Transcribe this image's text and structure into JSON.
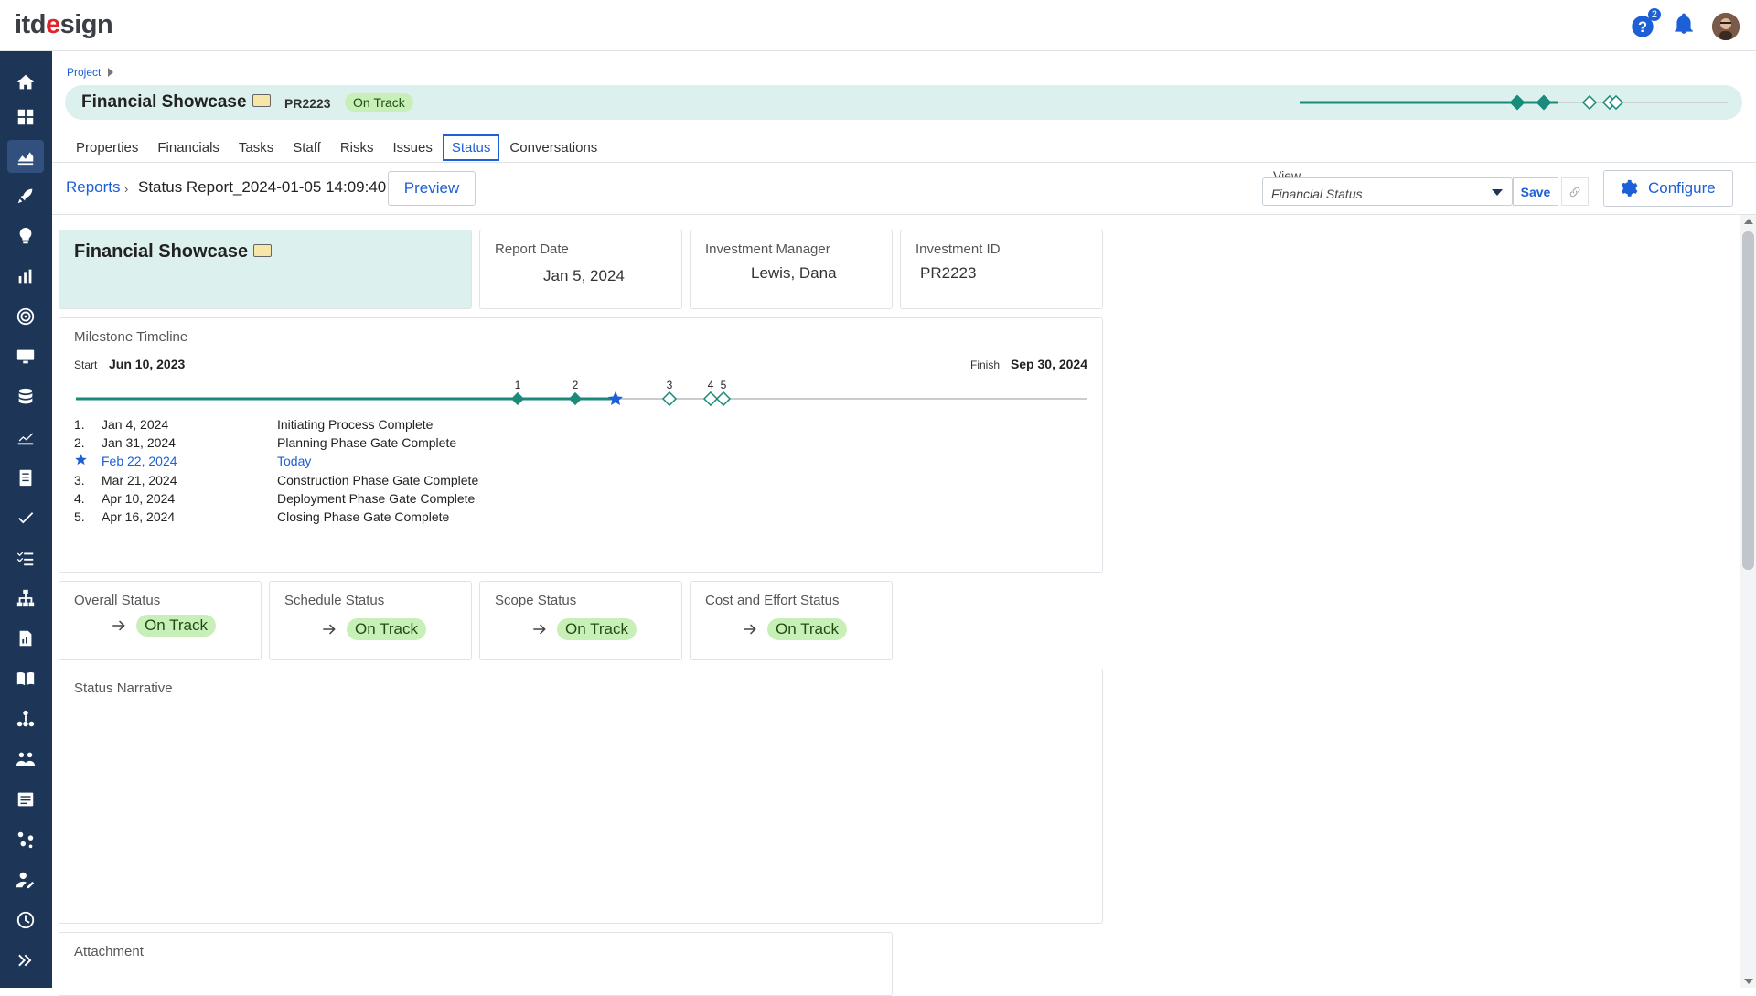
{
  "app": {
    "logo_main": "itd",
    "logo_accent": "e",
    "logo_rest": "sign",
    "help_badge": "2"
  },
  "breadcrumb": {
    "project": "Project"
  },
  "project": {
    "title": "Financial Showcase",
    "id": "PR2223",
    "status": "On Track"
  },
  "tabs": [
    {
      "label": "Properties"
    },
    {
      "label": "Financials"
    },
    {
      "label": "Tasks"
    },
    {
      "label": "Staff"
    },
    {
      "label": "Risks"
    },
    {
      "label": "Issues"
    },
    {
      "label": "Status"
    },
    {
      "label": "Conversations"
    }
  ],
  "toolbar": {
    "reports_link": "Reports",
    "report_title": "Status Report_2024-01-05 14:09:40",
    "preview_label": "Preview",
    "view_label": "View",
    "view_value": "Financial Status",
    "save_label": "Save",
    "configure_label": "Configure"
  },
  "summary": {
    "title": "Financial Showcase",
    "report_date_label": "Report Date",
    "report_date": "Jan 5, 2024",
    "manager_label": "Investment Manager",
    "manager": "Lewis, Dana",
    "inv_id_label": "Investment ID",
    "inv_id": "PR2223"
  },
  "milestones": {
    "title": "Milestone Timeline",
    "start_label": "Start",
    "start": "Jun 10, 2023",
    "finish_label": "Finish",
    "finish": "Sep 30, 2024",
    "items": [
      {
        "num": "1.",
        "date": "Jan 4, 2024",
        "name": "Initiating Process Complete"
      },
      {
        "num": "2.",
        "date": "Jan 31, 2024",
        "name": "Planning Phase Gate Complete"
      },
      {
        "num": "",
        "date": "Feb 22, 2024",
        "name": "Today"
      },
      {
        "num": "3.",
        "date": "Mar 21, 2024",
        "name": "Construction Phase Gate Complete"
      },
      {
        "num": "4.",
        "date": "Apr 10, 2024",
        "name": "Deployment Phase Gate Complete"
      },
      {
        "num": "5.",
        "date": "Apr 16, 2024",
        "name": "Closing Phase Gate Complete"
      }
    ],
    "markers": [
      "1",
      "2",
      "3",
      "4",
      "5"
    ]
  },
  "status": {
    "overall_label": "Overall Status",
    "overall": "On Track",
    "schedule_label": "Schedule Status",
    "schedule": "On Track",
    "scope_label": "Scope Status",
    "scope": "On Track",
    "cost_label": "Cost and Effort Status",
    "cost": "On Track"
  },
  "narrative": {
    "title": "Status Narrative"
  },
  "attachment": {
    "title": "Attachment"
  },
  "colors": {
    "teal": "#1a8a7a",
    "blue": "#1c5fd6",
    "nav": "#1d3557",
    "pill": "#c9efb9"
  }
}
